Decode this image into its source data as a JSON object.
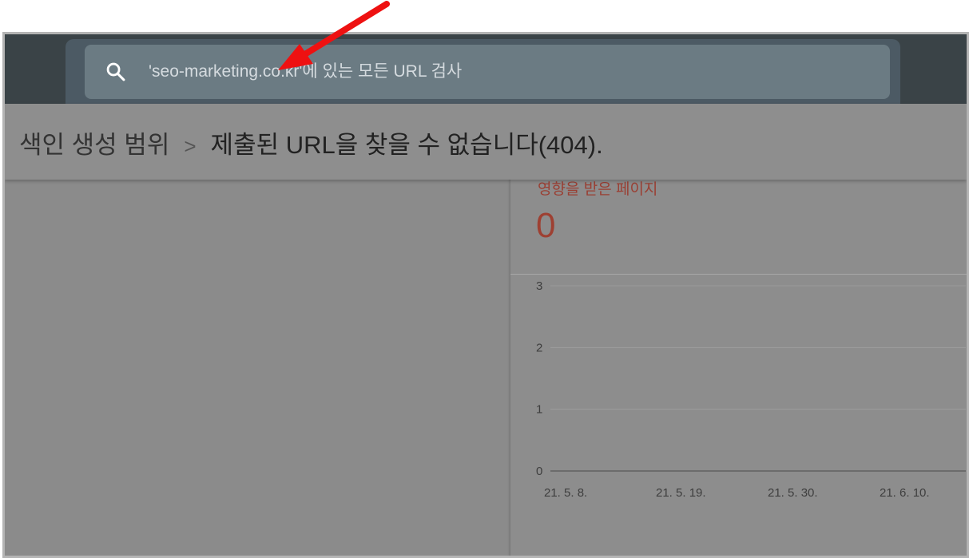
{
  "search": {
    "placeholder": "'seo-marketing.co.kr'에 있는 모든 URL 검사",
    "icon": "search-icon"
  },
  "breadcrumb": {
    "parent": "색인 생성 범위",
    "separator": ">",
    "current": "제출된 URL을 찾을 수 없습니다(404)."
  },
  "metric": {
    "label": "영향을 받은 페이지",
    "value": "0",
    "color": "#9e4032"
  },
  "chart_data": {
    "type": "line",
    "x": [
      "21. 5. 8.",
      "21. 5. 19.",
      "21. 5. 30.",
      "21. 6. 10."
    ],
    "y_ticks": [
      "0",
      "1",
      "2",
      "3"
    ],
    "ylim": [
      0,
      3
    ],
    "series": [
      {
        "values": [
          0,
          0,
          0,
          0
        ]
      }
    ],
    "grid": true
  },
  "annotation": {
    "arrow_color": "#ee1111"
  }
}
